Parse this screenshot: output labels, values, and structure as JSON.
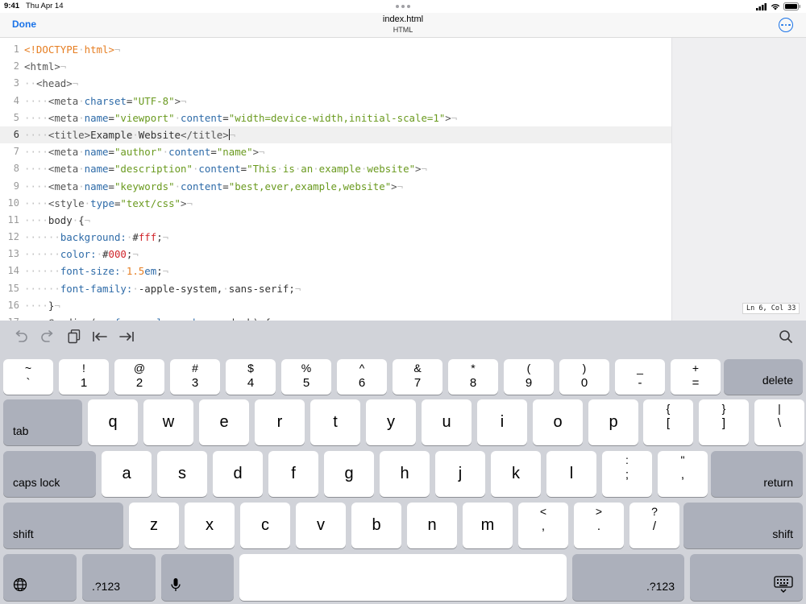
{
  "status": {
    "time": "9:41",
    "date": "Thu Apr 14"
  },
  "nav": {
    "done_label": "Done",
    "title": "index.html",
    "subtitle": "HTML",
    "more_icon": "ellipsis-circle-icon"
  },
  "editor": {
    "current_line": 6,
    "cursor_position": "Ln 6, Col 33",
    "lines": [
      "<!DOCTYPE html>¬",
      "<html>¬",
      "  <head>¬",
      "    <meta charset=\"UTF-8\">¬",
      "    <meta name=\"viewport\" content=\"width=device-width,initial-scale=1\">¬",
      "    <title>Example Website</title>¬",
      "    <meta name=\"author\" content=\"name\">¬",
      "    <meta name=\"description\" content=\"This is an example website\">¬",
      "    <meta name=\"keywords\" content=\"best,ever,example,website\">¬",
      "    <style type=\"text/css\">¬",
      "    body {¬",
      "      background: #fff;¬",
      "      color: #000;¬",
      "      font-size: 1.5em;¬",
      "      font-family: -apple-system, sans-serif;¬",
      "    }¬",
      "    @media (prefers-color-scheme: dark) {¬"
    ]
  },
  "toolbar": {
    "buttons": [
      "undo-icon",
      "redo-icon",
      "clipboard-icon",
      "indent-left-icon",
      "indent-right-icon"
    ],
    "search_icon": "magnifier-icon"
  },
  "keyboard": {
    "row1": [
      {
        "top": "~",
        "bot": "`"
      },
      {
        "top": "!",
        "bot": "1"
      },
      {
        "top": "@",
        "bot": "2"
      },
      {
        "top": "#",
        "bot": "3"
      },
      {
        "top": "$",
        "bot": "4"
      },
      {
        "top": "%",
        "bot": "5"
      },
      {
        "top": "^",
        "bot": "6"
      },
      {
        "top": "&",
        "bot": "7"
      },
      {
        "top": "*",
        "bot": "8"
      },
      {
        "top": "(",
        "bot": "9"
      },
      {
        "top": ")",
        "bot": "0"
      },
      {
        "top": "_",
        "bot": "-"
      },
      {
        "top": "+",
        "bot": "="
      }
    ],
    "delete_label": "delete",
    "tab_label": "tab",
    "row2": [
      "q",
      "w",
      "e",
      "r",
      "t",
      "y",
      "u",
      "i",
      "o",
      "p"
    ],
    "row2_sym": [
      {
        "top": "{",
        "bot": "["
      },
      {
        "top": "}",
        "bot": "]"
      },
      {
        "top": "|",
        "bot": "\\"
      }
    ],
    "caps_label": "caps lock",
    "row3": [
      "a",
      "s",
      "d",
      "f",
      "g",
      "h",
      "j",
      "k",
      "l"
    ],
    "row3_sym": [
      {
        "top": ":",
        "bot": ";"
      },
      {
        "top": "\"",
        "bot": ","
      }
    ],
    "return_label": "return",
    "shift_label": "shift",
    "row4": [
      "z",
      "x",
      "c",
      "v",
      "b",
      "n",
      "m"
    ],
    "row4_sym": [
      {
        "top": "<",
        "bot": ","
      },
      {
        "top": ">",
        "bot": "."
      },
      {
        "top": "?",
        "bot": "/"
      }
    ],
    "numbers_label": ".?123",
    "globe_icon": "globe-icon",
    "mic_icon": "microphone-icon",
    "dismiss_icon": "keyboard-dismiss-icon",
    "colors": {
      "key": "#ffffff",
      "function_key": "#acb0bb",
      "background": "#d1d3d9",
      "accent": "#1a73e8"
    }
  }
}
